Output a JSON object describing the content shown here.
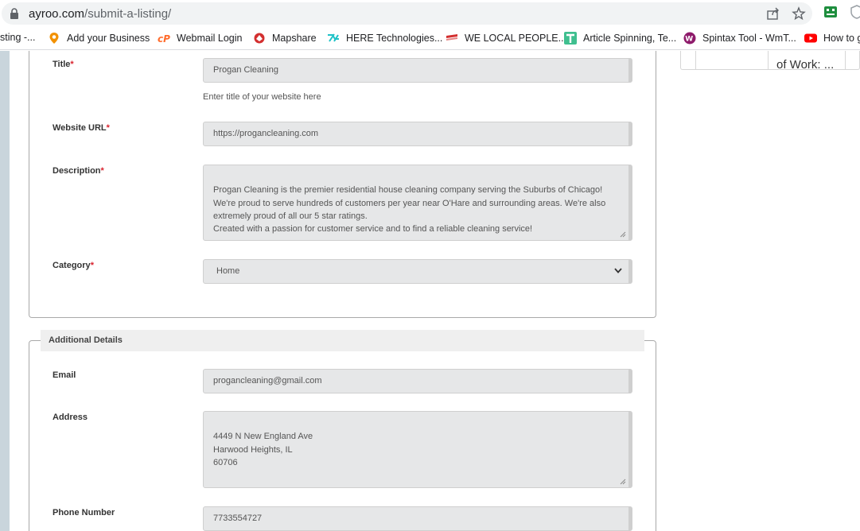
{
  "browser": {
    "url_host": "ayroo.com",
    "url_path": "/submit-a-listing/"
  },
  "bookmarks": [
    {
      "label": "sting -...",
      "icon": "partial-icon"
    },
    {
      "label": "Add your Business",
      "icon": "location-pin-icon"
    },
    {
      "label": "Webmail Login",
      "icon": "cpanel-icon"
    },
    {
      "label": "Mapshare",
      "icon": "mapshare-icon"
    },
    {
      "label": "HERE Technologies...",
      "icon": "here-icon"
    },
    {
      "label": "WE LOCAL PEOPLE...",
      "icon": "flag-icon"
    },
    {
      "label": "Article Spinning, Te...",
      "icon": "t-icon"
    },
    {
      "label": "Spintax Tool - WmT...",
      "icon": "spintax-icon"
    },
    {
      "label": "How to g",
      "icon": "youtube-icon"
    }
  ],
  "form": {
    "title_label": "Title",
    "title_value": "Progan Cleaning",
    "title_hint": "Enter title of your website here",
    "website_label": "Website URL",
    "website_value": "https://progancleaning.com",
    "description_label": "Description",
    "description_value": "Progan Cleaning is the premier residential house cleaning company serving the Suburbs of Chicago! We're proud to serve hundreds of customers per year near O'Hare and surrounding areas. We're also extremely proud of all our 5 star ratings.\nCreated with a passion for customer service and to find a reliable cleaning service!",
    "category_label": "Category",
    "category_value": "Home",
    "required_mark": "*"
  },
  "additional": {
    "legend": "Additional Details",
    "email_label": "Email",
    "email_value": "progancleaning@gmail.com",
    "address_label": "Address",
    "address_value": "4449 N New England Ave\nHarwood Heights, IL\n60706",
    "phone_label": "Phone Number",
    "phone_value": "7733554727"
  },
  "side": {
    "text": "of Work: ..."
  }
}
